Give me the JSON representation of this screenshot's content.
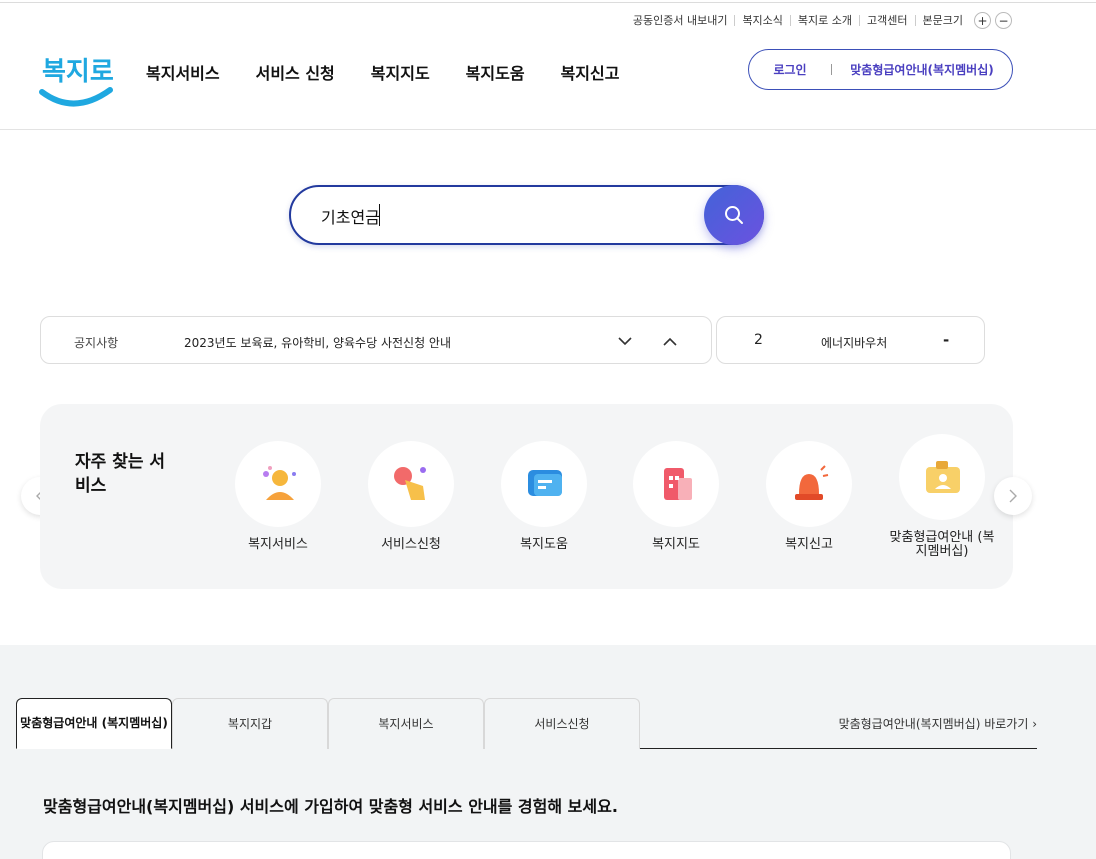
{
  "utility": {
    "items": [
      "공동인증서 내보내기",
      "복지소식",
      "복지로 소개",
      "고객센터",
      "본문크기"
    ],
    "plus": "+",
    "minus": "−"
  },
  "logo": {
    "text": "복지로"
  },
  "gnb": [
    "복지서비스",
    "서비스 신청",
    "복지지도",
    "복지도움",
    "복지신고"
  ],
  "auth": {
    "login": "로그인",
    "member": "맞춤형급여안내(복지멤버십)"
  },
  "search": {
    "value": "기초연금"
  },
  "notice": {
    "label": "공지사항",
    "text": "2023년도 보육료, 유아학비, 양육수당 사전신청 안내"
  },
  "energy": {
    "num": "2",
    "name": "에너지바우처",
    "dash": "-"
  },
  "frequent": {
    "title": "자주 찾는 서비스",
    "items": [
      {
        "name": "복지서비스",
        "icon": "person-icon"
      },
      {
        "name": "서비스신청",
        "icon": "tap-hand-icon"
      },
      {
        "name": "복지도움",
        "icon": "chat-bubble-icon"
      },
      {
        "name": "복지지도",
        "icon": "building-icon"
      },
      {
        "name": "복지신고",
        "icon": "siren-icon"
      },
      {
        "name": "맞춤형급여안내 (복지멤버십)",
        "icon": "id-card-icon"
      }
    ]
  },
  "tabs": {
    "items": [
      "맞춤형급여안내 (복지멤버십)",
      "복지지갑",
      "복지서비스",
      "서비스신청"
    ],
    "active": 0,
    "link": "맞춤형급여안내(복지멤버십) 바로가기 ›"
  },
  "intro": "맞춤형급여안내(복지멤버십) 서비스에 가입하여 맞춤형 서비스 안내를 경험해 보세요.",
  "colors": {
    "brand": "#233a9e",
    "accent": "#5a57e0",
    "logo": "#1fa8e0"
  }
}
